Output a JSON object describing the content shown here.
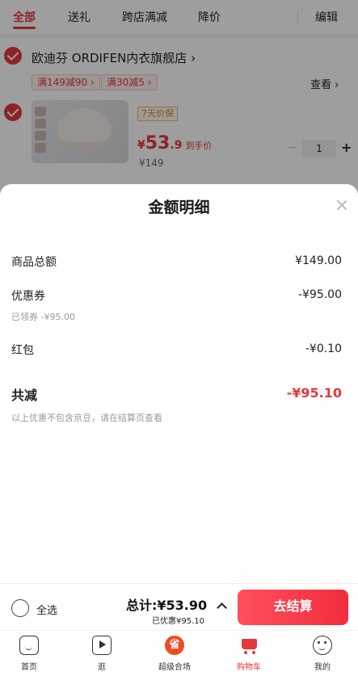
{
  "top_tabs": {
    "all": "全部",
    "gift": "送礼",
    "cross_store": "跨店满减",
    "price_drop": "降价",
    "edit": "编辑"
  },
  "shop": {
    "name": "欧迪芬 ORDIFEN内衣旗舰店",
    "name_arrow": "›",
    "promos": [
      "满149减90 ›",
      "满30减5 ›"
    ],
    "view": "查看 ›"
  },
  "product": {
    "guarantee": "7天价保",
    "price_currency": "¥",
    "price_integer": "53",
    "price_decimal": ".9",
    "price_tag": "到手价",
    "original_price": "¥149",
    "qty_minus": "−",
    "quantity": "1",
    "qty_plus": "+"
  },
  "sheet": {
    "title": "金额明细",
    "rows": [
      {
        "label": "商品总额",
        "value": "¥149.00"
      },
      {
        "label": "优惠券",
        "value": "-¥95.00",
        "sub": "已领券 -¥95.00"
      },
      {
        "label": "红包",
        "value": "-¥0.10"
      }
    ],
    "total_label": "共减",
    "total_value": "-¥95.10",
    "note": "以上优惠不包含京豆，请在结算页查看"
  },
  "checkout": {
    "select_all": "全选",
    "total": "总计:¥53.90",
    "discount": "已优惠¥95.10",
    "pay_button": "去结算"
  },
  "tabbar": {
    "items": [
      {
        "label": "首页",
        "icon": "home-icon"
      },
      {
        "label": "逛",
        "icon": "video-icon"
      },
      {
        "label": "超级合场",
        "icon": "super-venue-icon",
        "glyph": "省"
      },
      {
        "label": "购物车",
        "icon": "cart-icon",
        "active": true
      },
      {
        "label": "我的",
        "icon": "profile-icon"
      }
    ]
  },
  "colors": {
    "accent": "#e4393c",
    "pay_gradient_start": "#ff4f5b",
    "pay_gradient_end": "#f22d3d"
  }
}
